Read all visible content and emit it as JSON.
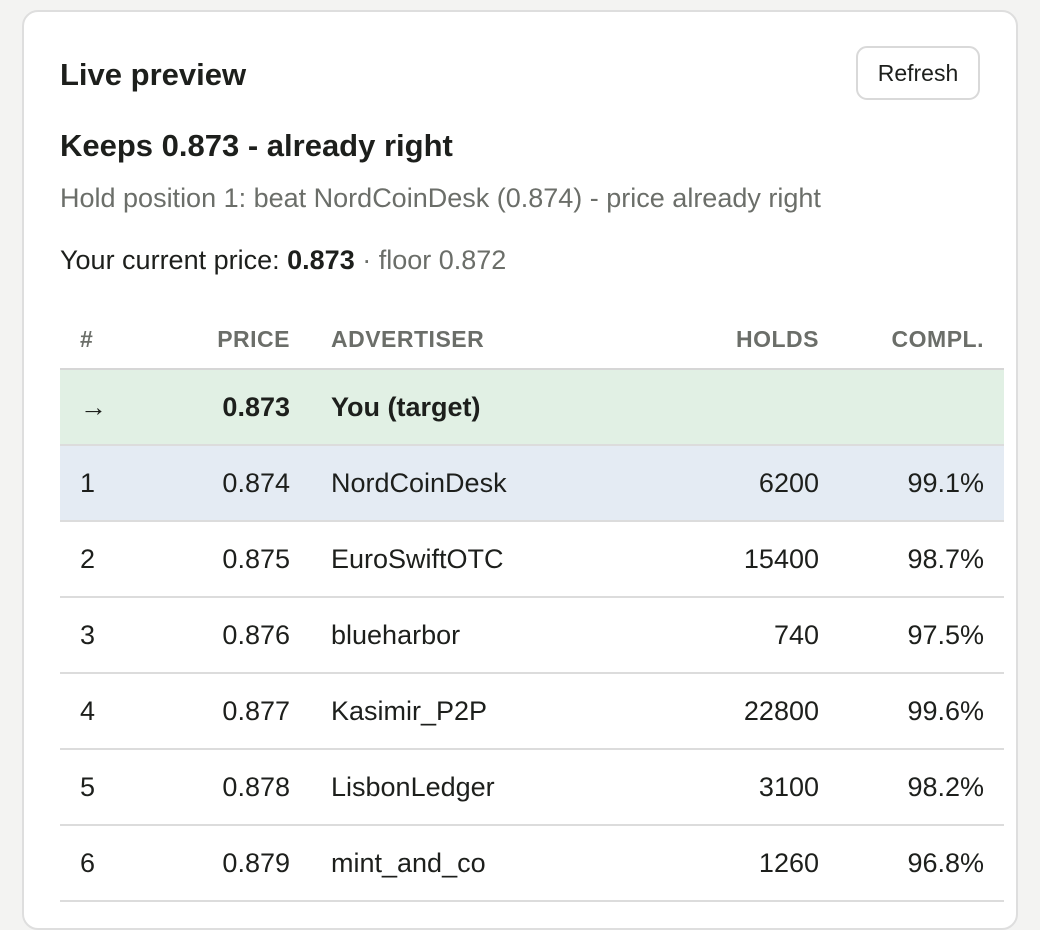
{
  "panel": {
    "title": "Live preview",
    "refresh_label": "Refresh"
  },
  "result": {
    "headline": "Keeps 0.873 - already right",
    "subtitle": "Hold position 1: beat NordCoinDesk (0.874) - price already right",
    "current_price_label": "Your current price:",
    "current_price_value": "0.873",
    "floor_text": "· floor 0.872"
  },
  "table": {
    "headers": {
      "rank": "#",
      "price": "PRICE",
      "advertiser": "ADVERTISER",
      "holds": "HOLDS",
      "completion": "COMPL."
    },
    "target_row": {
      "rank": "→",
      "price": "0.873",
      "advertiser": "You (target)",
      "holds": "",
      "completion": ""
    },
    "rows": [
      {
        "rank": "1",
        "price": "0.874",
        "advertiser": "NordCoinDesk",
        "holds": "6200",
        "completion": "99.1%"
      },
      {
        "rank": "2",
        "price": "0.875",
        "advertiser": "EuroSwiftOTC",
        "holds": "15400",
        "completion": "98.7%"
      },
      {
        "rank": "3",
        "price": "0.876",
        "advertiser": "blueharbor",
        "holds": "740",
        "completion": "97.5%"
      },
      {
        "rank": "4",
        "price": "0.877",
        "advertiser": "Kasimir_P2P",
        "holds": "22800",
        "completion": "99.6%"
      },
      {
        "rank": "5",
        "price": "0.878",
        "advertiser": "LisbonLedger",
        "holds": "3100",
        "completion": "98.2%"
      },
      {
        "rank": "6",
        "price": "0.879",
        "advertiser": "mint_and_co",
        "holds": "1260",
        "completion": "96.8%"
      }
    ]
  },
  "colors": {
    "target_row_bg": "#e1f0e4",
    "highlight_row_bg": "#e4ebf3",
    "muted_text": "#6b6e69"
  }
}
